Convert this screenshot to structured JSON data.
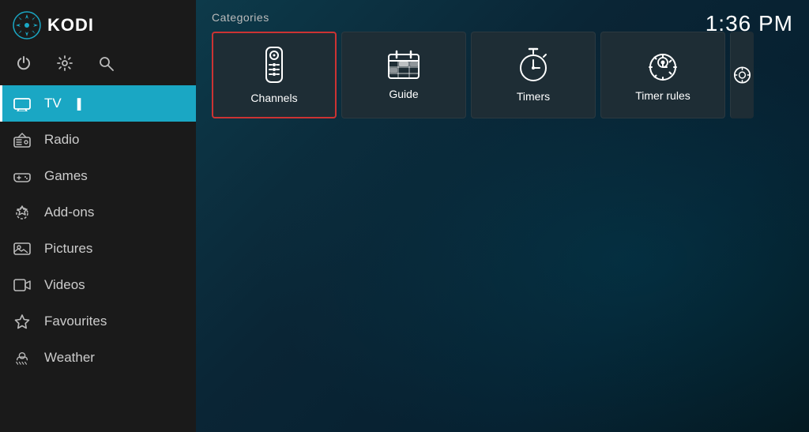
{
  "app": {
    "title": "KODI",
    "clock": "1:36 PM"
  },
  "sidebar": {
    "icons": [
      {
        "name": "power-icon",
        "symbol": "⏻"
      },
      {
        "name": "settings-icon",
        "symbol": "⚙"
      },
      {
        "name": "search-icon",
        "symbol": "🔍"
      }
    ],
    "nav_items": [
      {
        "id": "tv",
        "label": "TV",
        "active": true
      },
      {
        "id": "radio",
        "label": "Radio",
        "active": false
      },
      {
        "id": "games",
        "label": "Games",
        "active": false
      },
      {
        "id": "addons",
        "label": "Add-ons",
        "active": false
      },
      {
        "id": "pictures",
        "label": "Pictures",
        "active": false
      },
      {
        "id": "videos",
        "label": "Videos",
        "active": false
      },
      {
        "id": "favourites",
        "label": "Favourites",
        "active": false
      },
      {
        "id": "weather",
        "label": "Weather",
        "active": false
      }
    ]
  },
  "main": {
    "categories_label": "Categories",
    "tiles": [
      {
        "id": "channels",
        "label": "Channels",
        "selected": true
      },
      {
        "id": "guide",
        "label": "Guide",
        "selected": false
      },
      {
        "id": "timers",
        "label": "Timers",
        "selected": false
      },
      {
        "id": "timer-rules",
        "label": "Timer rules",
        "selected": false
      }
    ]
  },
  "colors": {
    "active_nav": "#1aa7c4",
    "selected_tile_border": "#cc3333",
    "sidebar_bg": "#1a1a1a",
    "main_bg_start": "#0d3a4a"
  }
}
